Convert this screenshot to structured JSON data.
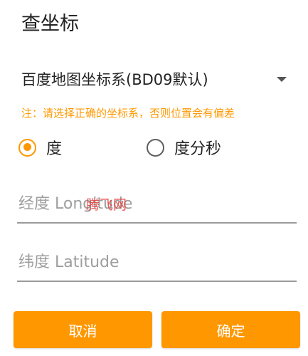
{
  "dialog": {
    "title": "查坐标"
  },
  "coordinate_system": {
    "selected": "百度地图坐标系(BD09默认)"
  },
  "note": "注：请选择正确的坐标系，否则位置会有偏差",
  "format_options": {
    "options": [
      {
        "label": "度",
        "selected": true
      },
      {
        "label": "度分秒",
        "selected": false
      }
    ]
  },
  "fields": {
    "longitude_placeholder": "经度 Longitude",
    "latitude_placeholder": "纬度 Latitude"
  },
  "watermark": "腾飞网",
  "buttons": {
    "cancel": "取消",
    "confirm": "确定"
  },
  "colors": {
    "accent": "#ff9800",
    "watermark": "#e53935"
  }
}
